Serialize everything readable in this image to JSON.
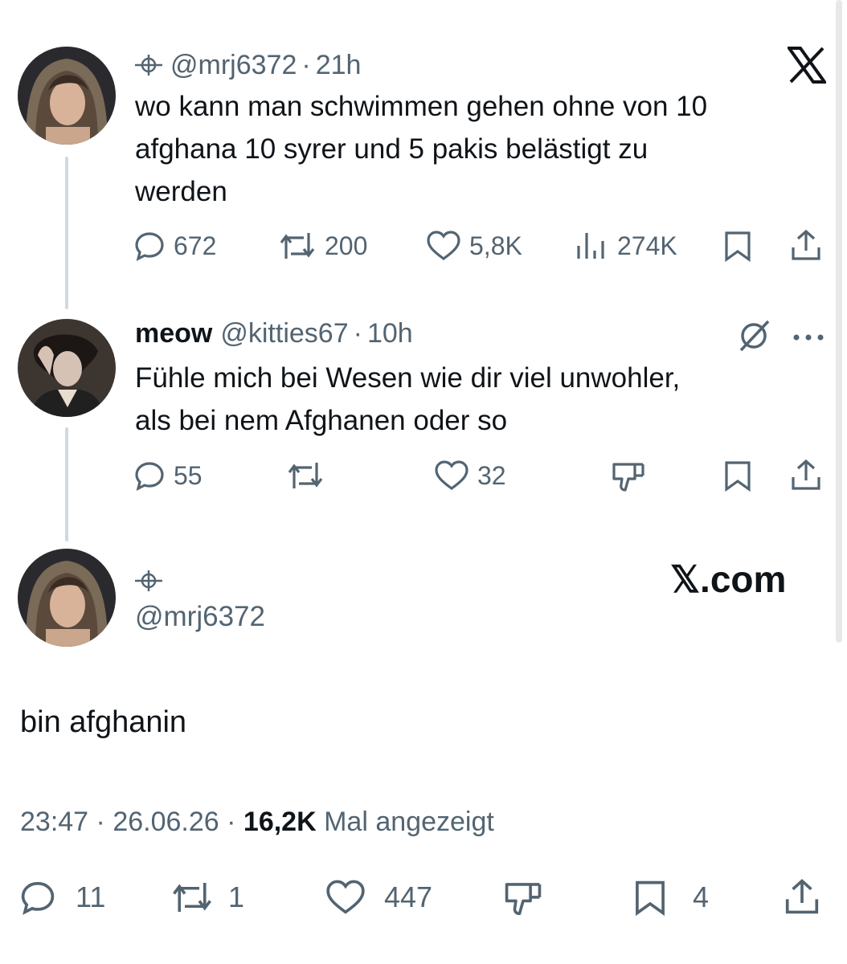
{
  "tweet1": {
    "handle": "@mrj6372",
    "time": "21h",
    "text_lines": [
      "wo kann man schwimmen gehen ohne von 10",
      "afghana 10 syrer und 5 pakis belästigt zu",
      "werden"
    ],
    "replies": "672",
    "reposts": "200",
    "likes": "5,8K",
    "views": "274K"
  },
  "tweet2": {
    "name": "meow",
    "handle": "@kitties67",
    "time": "10h",
    "text_lines": [
      "Fühle mich bei Wesen wie dir viel unwohler,",
      "als bei nem Afghanen oder so"
    ],
    "replies": "55",
    "likes": "32"
  },
  "main_tweet": {
    "handle": "@mrj6372",
    "brand": "𝕏.com",
    "text": "bin afghanin",
    "time": "23:47",
    "date": "26.06.26",
    "views": "16,2K",
    "views_label": "Mal angezeigt",
    "replies": "11",
    "reposts": "1",
    "likes": "447",
    "bookmarks": "4"
  },
  "icons": [
    "crosshair-icon",
    "x-logo-icon",
    "reply-icon",
    "repost-icon",
    "like-icon",
    "views-icon",
    "bookmark-icon",
    "share-icon",
    "grok-icon",
    "more-icon",
    "downvote-icon"
  ],
  "colors": {
    "text": "#0f1419",
    "muted": "#536471",
    "line": "#cfd9de"
  }
}
